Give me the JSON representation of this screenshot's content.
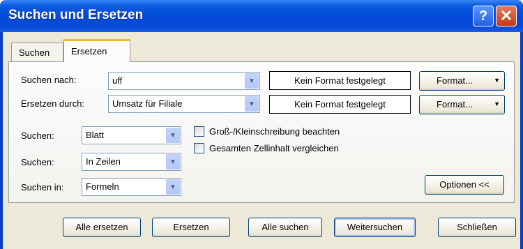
{
  "window": {
    "title": "Suchen und Ersetzen"
  },
  "tabs": [
    {
      "label": "Suchen"
    },
    {
      "label": "Ersetzen"
    }
  ],
  "search": {
    "label": "Suchen nach:",
    "value": "uff",
    "format_preview": "Kein Format festgelegt",
    "format_button": "Format..."
  },
  "replace": {
    "label": "Ersetzen durch:",
    "value": "Umsatz für Filiale",
    "format_preview": "Kein Format festgelegt",
    "format_button": "Format..."
  },
  "options": {
    "within": {
      "label": "Suchen:",
      "value": "Blatt"
    },
    "search_order": {
      "label": "Suchen:",
      "value": "In Zeilen"
    },
    "look_in": {
      "label": "Suchen in:",
      "value": "Formeln"
    },
    "match_case": "Groß-/Kleinschreibung beachten",
    "match_entire": "Gesamten Zellinhalt vergleichen",
    "options_button": "Optionen <<"
  },
  "buttons": {
    "replace_all": "Alle ersetzen",
    "replace": "Ersetzen",
    "find_all": "Alle suchen",
    "find_next": "Weitersuchen",
    "close": "Schließen"
  },
  "colors": {
    "title_bar": "#0a4bd8",
    "dialog_bg": "#ece9d8",
    "close_button": "#c3381a",
    "tab_accent": "#f2b93c"
  }
}
